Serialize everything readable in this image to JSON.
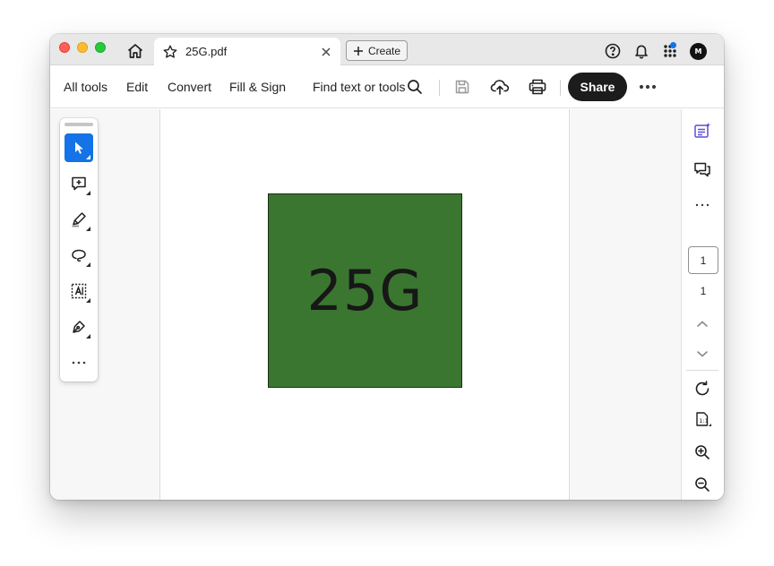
{
  "tab": {
    "title": "25G.pdf"
  },
  "create": {
    "label": "Create"
  },
  "toolbar": {
    "all_tools": "All tools",
    "edit": "Edit",
    "convert": "Convert",
    "fill_sign": "Fill & Sign",
    "find": "Find text or tools",
    "share": "Share"
  },
  "account": {
    "initials": "M"
  },
  "document": {
    "box_text": "25G",
    "box_color": "#3a7630"
  },
  "pages": {
    "current": "1",
    "total": "1"
  },
  "colors": {
    "accent": "#1473e6",
    "share_bg": "#1c1c1c"
  }
}
